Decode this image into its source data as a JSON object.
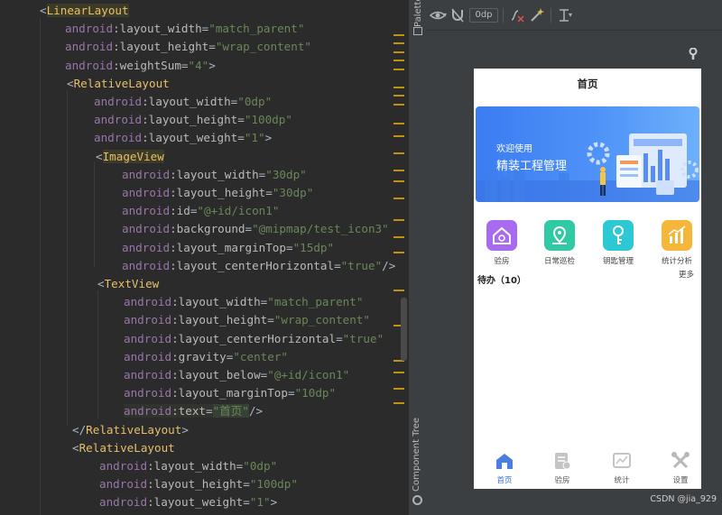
{
  "editor": {
    "lines": [
      {
        "parts": [
          {
            "t": "<",
            "c": "tk-punc"
          },
          {
            "t": "LinearLayout",
            "c": "tk-tag hl-tag"
          }
        ]
      },
      {
        "parts": [
          {
            "t": "android",
            "c": "tk-ns"
          },
          {
            "t": ":layout_width",
            "c": "tk-attr"
          },
          {
            "t": "=",
            "c": "tk-punc"
          },
          {
            "t": "\"match_parent\"",
            "c": "tk-str"
          }
        ]
      },
      {
        "parts": [
          {
            "t": "android",
            "c": "tk-ns"
          },
          {
            "t": ":layout_height",
            "c": "tk-attr"
          },
          {
            "t": "=",
            "c": "tk-punc"
          },
          {
            "t": "\"wrap_content\"",
            "c": "tk-str"
          }
        ]
      },
      {
        "parts": [
          {
            "t": "android",
            "c": "tk-ns"
          },
          {
            "t": ":weightSum",
            "c": "tk-attr"
          },
          {
            "t": "=",
            "c": "tk-punc"
          },
          {
            "t": "\"4\"",
            "c": "tk-str"
          },
          {
            "t": ">",
            "c": "tk-punc"
          }
        ]
      },
      {
        "parts": [
          {
            "t": "<",
            "c": "tk-punc"
          },
          {
            "t": "RelativeLayout",
            "c": "tk-tag"
          }
        ]
      },
      {
        "parts": [
          {
            "t": "android",
            "c": "tk-ns"
          },
          {
            "t": ":layout_width",
            "c": "tk-attr"
          },
          {
            "t": "=",
            "c": "tk-punc"
          },
          {
            "t": "\"0dp\"",
            "c": "tk-str"
          }
        ]
      },
      {
        "parts": [
          {
            "t": "android",
            "c": "tk-ns"
          },
          {
            "t": ":layout_height",
            "c": "tk-attr"
          },
          {
            "t": "=",
            "c": "tk-punc"
          },
          {
            "t": "\"100dp\"",
            "c": "tk-str"
          }
        ]
      },
      {
        "parts": [
          {
            "t": "android",
            "c": "tk-ns"
          },
          {
            "t": ":layout_weight",
            "c": "tk-attr"
          },
          {
            "t": "=",
            "c": "tk-punc"
          },
          {
            "t": "\"1\"",
            "c": "tk-str"
          },
          {
            "t": ">",
            "c": "tk-punc"
          }
        ]
      },
      {
        "parts": [
          {
            "t": "<",
            "c": "tk-punc"
          },
          {
            "t": "ImageView",
            "c": "tk-tag hl-tag"
          }
        ]
      },
      {
        "parts": [
          {
            "t": "android",
            "c": "tk-ns"
          },
          {
            "t": ":layout_width",
            "c": "tk-attr"
          },
          {
            "t": "=",
            "c": "tk-punc"
          },
          {
            "t": "\"30dp\"",
            "c": "tk-str"
          }
        ]
      },
      {
        "parts": [
          {
            "t": "android",
            "c": "tk-ns"
          },
          {
            "t": ":layout_height",
            "c": "tk-attr"
          },
          {
            "t": "=",
            "c": "tk-punc"
          },
          {
            "t": "\"30dp\"",
            "c": "tk-str"
          }
        ]
      },
      {
        "parts": [
          {
            "t": "android",
            "c": "tk-ns"
          },
          {
            "t": ":id",
            "c": "tk-attr"
          },
          {
            "t": "=",
            "c": "tk-punc"
          },
          {
            "t": "\"@+id/icon1\"",
            "c": "tk-str"
          }
        ]
      },
      {
        "parts": [
          {
            "t": "android",
            "c": "tk-ns"
          },
          {
            "t": ":background",
            "c": "tk-attr"
          },
          {
            "t": "=",
            "c": "tk-punc"
          },
          {
            "t": "\"@mipmap/test_icon3\"",
            "c": "tk-str"
          }
        ]
      },
      {
        "parts": [
          {
            "t": "android",
            "c": "tk-ns"
          },
          {
            "t": ":layout_marginTop",
            "c": "tk-attr"
          },
          {
            "t": "=",
            "c": "tk-punc"
          },
          {
            "t": "\"15dp\"",
            "c": "tk-str"
          }
        ]
      },
      {
        "parts": [
          {
            "t": "android",
            "c": "tk-ns"
          },
          {
            "t": ":layout_centerHorizontal",
            "c": "tk-attr"
          },
          {
            "t": "=",
            "c": "tk-punc"
          },
          {
            "t": "\"true\"",
            "c": "tk-str"
          },
          {
            "t": "/>",
            "c": "tk-punc"
          }
        ]
      },
      {
        "parts": [
          {
            "t": "<",
            "c": "tk-punc"
          },
          {
            "t": "TextView",
            "c": "tk-tag"
          }
        ]
      },
      {
        "parts": [
          {
            "t": "android",
            "c": "tk-ns"
          },
          {
            "t": ":layout_width",
            "c": "tk-attr"
          },
          {
            "t": "=",
            "c": "tk-punc"
          },
          {
            "t": "\"match_parent\"",
            "c": "tk-str"
          }
        ]
      },
      {
        "parts": [
          {
            "t": "android",
            "c": "tk-ns"
          },
          {
            "t": ":layout_height",
            "c": "tk-attr"
          },
          {
            "t": "=",
            "c": "tk-punc"
          },
          {
            "t": "\"wrap_content\"",
            "c": "tk-str"
          }
        ]
      },
      {
        "parts": [
          {
            "t": "android",
            "c": "tk-ns"
          },
          {
            "t": ":layout_centerHorizontal",
            "c": "tk-attr"
          },
          {
            "t": "=",
            "c": "tk-punc"
          },
          {
            "t": "\"true\"",
            "c": "tk-str"
          }
        ]
      },
      {
        "parts": [
          {
            "t": "android",
            "c": "tk-ns"
          },
          {
            "t": ":gravity",
            "c": "tk-attr"
          },
          {
            "t": "=",
            "c": "tk-punc"
          },
          {
            "t": "\"center\"",
            "c": "tk-str"
          }
        ]
      },
      {
        "parts": [
          {
            "t": "android",
            "c": "tk-ns"
          },
          {
            "t": ":layout_below",
            "c": "tk-attr"
          },
          {
            "t": "=",
            "c": "tk-punc"
          },
          {
            "t": "\"@+id/icon1\"",
            "c": "tk-str"
          }
        ]
      },
      {
        "parts": [
          {
            "t": "android",
            "c": "tk-ns"
          },
          {
            "t": ":layout_marginTop",
            "c": "tk-attr"
          },
          {
            "t": "=",
            "c": "tk-punc"
          },
          {
            "t": "\"10dp\"",
            "c": "tk-str"
          }
        ]
      },
      {
        "parts": [
          {
            "t": "android",
            "c": "tk-ns hl-line"
          },
          {
            "t": ":text",
            "c": "tk-attr hl-line"
          },
          {
            "t": "=",
            "c": "tk-punc hl-line"
          },
          {
            "t": "\"首页\"",
            "c": "tk-str hl-str"
          },
          {
            "t": "/>",
            "c": "tk-punc"
          }
        ]
      },
      {
        "parts": [
          {
            "t": "</",
            "c": "tk-punc"
          },
          {
            "t": "RelativeLayout",
            "c": "tk-tag"
          },
          {
            "t": ">",
            "c": "tk-punc"
          }
        ]
      },
      {
        "parts": [
          {
            "t": "<",
            "c": "tk-punc"
          },
          {
            "t": "RelativeLayout",
            "c": "tk-tag"
          }
        ]
      },
      {
        "parts": [
          {
            "t": "android",
            "c": "tk-ns"
          },
          {
            "t": ":layout_width",
            "c": "tk-attr"
          },
          {
            "t": "=",
            "c": "tk-punc"
          },
          {
            "t": "\"0dp\"",
            "c": "tk-str"
          }
        ]
      },
      {
        "parts": [
          {
            "t": "android",
            "c": "tk-ns"
          },
          {
            "t": ":layout_height",
            "c": "tk-attr"
          },
          {
            "t": "=",
            "c": "tk-punc"
          },
          {
            "t": "\"100dp\"",
            "c": "tk-str"
          }
        ]
      },
      {
        "parts": [
          {
            "t": "android",
            "c": "tk-ns"
          },
          {
            "t": ":layout_weight",
            "c": "tk-attr"
          },
          {
            "t": "=",
            "c": "tk-punc"
          },
          {
            "t": "\"1\"",
            "c": "tk-str"
          },
          {
            "t": ">",
            "c": "tk-punc"
          }
        ]
      }
    ]
  },
  "side_strip": {
    "palette_label": "Palette",
    "component_tree_label": "Component Tree"
  },
  "toolbar": {
    "margin_value": "0dp"
  },
  "phone": {
    "title": "首页",
    "banner": {
      "line1": "欢迎使用",
      "line2": "精装工程管理"
    },
    "quick_items": [
      {
        "label": "验房",
        "color": "#a76af0",
        "icon": "house-icon"
      },
      {
        "label": "日常巡检",
        "color": "#2fc9a3",
        "icon": "location-pin-icon"
      },
      {
        "label": "钥匙管理",
        "color": "#2cc8d4",
        "icon": "key-icon"
      },
      {
        "label": "统计分析",
        "color": "#f5b63a",
        "icon": "bar-chart-icon"
      }
    ],
    "todo_label": "待办（10）",
    "more_label": "更多",
    "bottom_nav": [
      {
        "label": "首页",
        "icon": "home-icon"
      },
      {
        "label": "验房",
        "icon": "inspect-icon"
      },
      {
        "label": "统计",
        "icon": "chart-icon"
      },
      {
        "label": "设置",
        "icon": "tools-icon"
      }
    ]
  },
  "watermark": "CSDN @jia_929"
}
